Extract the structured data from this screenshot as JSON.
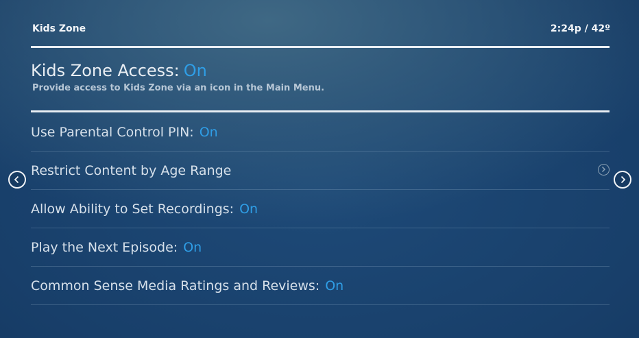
{
  "header": {
    "title": "Kids Zone",
    "clock": "2:24p / 42º"
  },
  "access": {
    "label": "Kids Zone Access:",
    "value": "On",
    "description": "Provide access to Kids Zone via an icon in the Main Menu."
  },
  "settings": [
    {
      "label": "Use Parental Control PIN:",
      "value": "On"
    },
    {
      "label": "Restrict Content by Age Range",
      "value": ""
    },
    {
      "label": "Allow Ability to Set Recordings:",
      "value": "On"
    },
    {
      "label": "Play the Next Episode:",
      "value": "On"
    },
    {
      "label": "Common Sense Media Ratings and Reviews:",
      "value": "On"
    }
  ],
  "icons": {
    "prev": "chevron-left-circle-icon",
    "next": "chevron-right-circle-icon",
    "row_detail": "chevron-right-circle-icon"
  },
  "colors": {
    "accent": "#2f9ee6",
    "background": "#1e4a78"
  }
}
